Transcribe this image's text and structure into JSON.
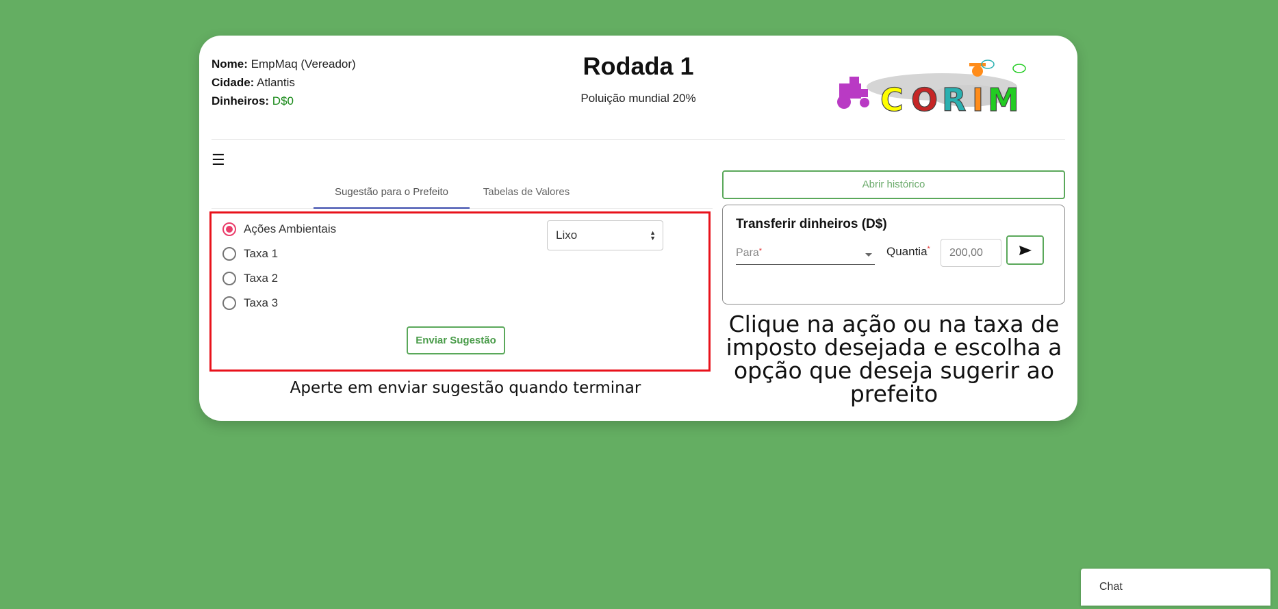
{
  "player": {
    "name_label": "Nome:",
    "name_value": "EmpMaq (Vereador)",
    "city_label": "Cidade:",
    "city_value": "Atlantis",
    "money_label": "Dinheiros:",
    "money_value": "D$0"
  },
  "round": {
    "title": "Rodada 1",
    "subtitle": "Poluição mundial 20%"
  },
  "logo": {
    "letters": [
      "C",
      "O",
      "R",
      "I",
      "M"
    ],
    "colors": [
      "#ff0",
      "#c62626",
      "#2ab0b0",
      "#ff8c1a",
      "#22cc22"
    ]
  },
  "menu_icon": "☰",
  "tabs": [
    {
      "label": "Sugestão para o Prefeito",
      "active": true
    },
    {
      "label": "Tabelas de Valores",
      "active": false
    }
  ],
  "suggestion": {
    "options": [
      {
        "label": "Ações Ambientais",
        "selected": true
      },
      {
        "label": "Taxa 1",
        "selected": false
      },
      {
        "label": "Taxa 2",
        "selected": false
      },
      {
        "label": "Taxa 3",
        "selected": false
      }
    ],
    "select_value": "Lixo",
    "send_label": "Enviar Sugestão",
    "hint": "Aperte em enviar sugestão quando terminar"
  },
  "history_button": "Abrir histórico",
  "transfer": {
    "title": "Transferir dinheiros (D$)",
    "to_label": "Para",
    "amount_label": "Quantia",
    "amount_placeholder": "200,00",
    "required_mark": "*"
  },
  "hint_right": "Clique na ação ou na taxa de imposto desejada e escolha a opção que deseja sugerir ao prefeito",
  "chat_label": "Chat"
}
